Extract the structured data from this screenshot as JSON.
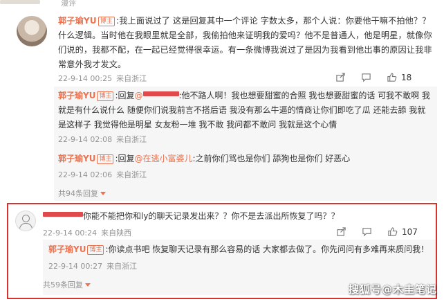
{
  "top": {
    "fragment": "漫评"
  },
  "comment1": {
    "user": "郭子瑜YU",
    "badge": "博主",
    "text": ":我上面说过了 这是回复其中一个评论 字数太多，那个人说：你要他干嘛不拍他？？什么逻辑。当时他在我眼里就是全部，我偷拍他来证明我的爱吗？他不是普通人，他是明星，就像你们说的，我都不配，在一起已经觉得很幸运。有一条微博我说过了是因为我看到他出事的原因让我非常意外我才发文。",
    "date": "22-9-14 00:25",
    "source": "来自浙江",
    "likes": "18",
    "replies": [
      {
        "user": "郭子瑜YU",
        "badge": "博主",
        "prefix": ":回复",
        "mention_visible": "@",
        "text": ":他不路人啊！我也想要甜蜜的合照 我也想要甜蜜的话 可我不敢啊 我就是有什么说什么 随便你们说我前言不搭后语 我没有那么牛逼的情商让你们即吃了瓜 还能去舔 我就是这样子 我觉得他是明星 女友粉一堆 我不敢 我问都不敢问 我就是这个心情",
        "date": "22-9-14 02:08",
        "source": "来自浙江"
      },
      {
        "user": "郭子瑜YU",
        "badge": "博主",
        "prefix": ":回复",
        "mention": "@在逃小富婆儿",
        "text": ":之前你们骂也是你们 舔狗也是你们 好恶心",
        "date": "22-9-14 02:06",
        "source": "来自浙江"
      }
    ],
    "more": "共94条回复"
  },
  "comment2": {
    "user": "",
    "text": "你能不能把你和ly的聊天记录发出来？？你不是去派出所恢复了吗？？",
    "date": "22-9-14 00:24",
    "source": "来自陕西",
    "likes": "107",
    "replies": [
      {
        "user": "郭子瑜YU",
        "badge": "博主",
        "text": ":你读点书吧 恢复聊天记录有那么容易的话 大家都去做了。你先问问有多难再来质问我！",
        "date": "22-9-14 00:27",
        "source": "来自浙江"
      }
    ],
    "more": "共59条回复"
  },
  "colors": {
    "accent": "#eb7350",
    "highlight": "#d9322e",
    "redaction": "#e04a4a"
  },
  "watermark": "搜狐号@木圭笔记",
  "icons": [
    "share-icon",
    "comment-icon",
    "like-icon"
  ]
}
